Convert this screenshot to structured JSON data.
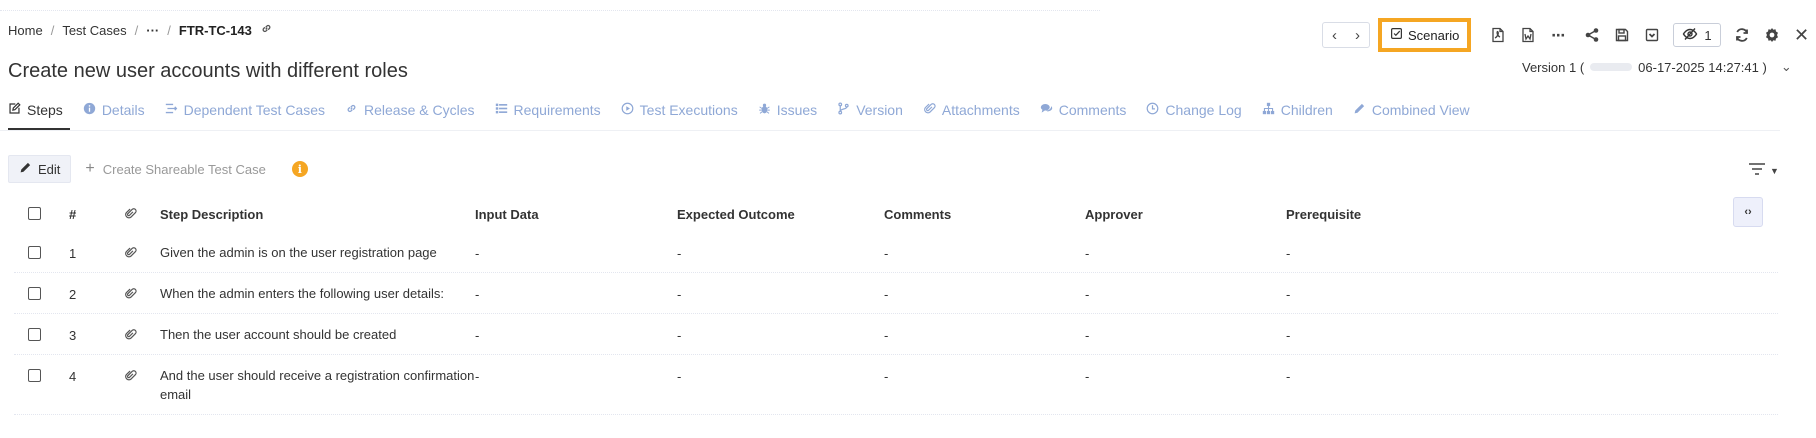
{
  "breadcrumb": {
    "home": "Home",
    "test_cases": "Test Cases",
    "ellipsis": "···",
    "current": "FTR-TC-143"
  },
  "toolbar": {
    "prev": "‹",
    "next": "›",
    "scenario_label": "Scenario",
    "watch_count": "1"
  },
  "title": "Create new user accounts with different roles",
  "version": {
    "label": "Version 1 (",
    "date": "06-17-2025 14:27:41 )"
  },
  "tabs": [
    {
      "label": "Steps",
      "icon": "edit-icon"
    },
    {
      "label": "Details",
      "icon": "info-icon"
    },
    {
      "label": "Dependent Test Cases",
      "icon": "dependency-icon"
    },
    {
      "label": "Release & Cycles",
      "icon": "link-icon"
    },
    {
      "label": "Requirements",
      "icon": "list-icon"
    },
    {
      "label": "Test Executions",
      "icon": "play-icon"
    },
    {
      "label": "Issues",
      "icon": "bug-icon"
    },
    {
      "label": "Version",
      "icon": "branch-icon"
    },
    {
      "label": "Attachments",
      "icon": "paperclip-icon"
    },
    {
      "label": "Comments",
      "icon": "comments-icon"
    },
    {
      "label": "Change Log",
      "icon": "clock-icon"
    },
    {
      "label": "Children",
      "icon": "sitemap-icon"
    },
    {
      "label": "Combined View",
      "icon": "pencil-icon"
    }
  ],
  "actions": {
    "edit": "Edit",
    "create_shareable": "Create Shareable Test Case"
  },
  "table": {
    "headers": {
      "num": "#",
      "step": "Step Description",
      "input": "Input Data",
      "expected": "Expected Outcome",
      "comments": "Comments",
      "approver": "Approver",
      "prerequisite": "Prerequisite"
    },
    "rows": [
      {
        "num": "1",
        "desc": "Given the admin is on the user registration page",
        "input": "-",
        "expected": "-",
        "comments": "-",
        "approver": "-",
        "prerequisite": "-"
      },
      {
        "num": "2",
        "desc": "When the admin enters the following user details:",
        "input": "-",
        "expected": "-",
        "comments": "-",
        "approver": "-",
        "prerequisite": "-"
      },
      {
        "num": "3",
        "desc": "Then the user account should be created",
        "input": "-",
        "expected": "-",
        "comments": "-",
        "approver": "-",
        "prerequisite": "-"
      },
      {
        "num": "4",
        "desc": "And the user should receive a registration confirmation email",
        "input": "-",
        "expected": "-",
        "comments": "-",
        "approver": "-",
        "prerequisite": "-"
      }
    ]
  },
  "colors": {
    "accent_orange": "#f5a623",
    "tab_inactive": "#8fa8d6",
    "text": "#333333"
  }
}
